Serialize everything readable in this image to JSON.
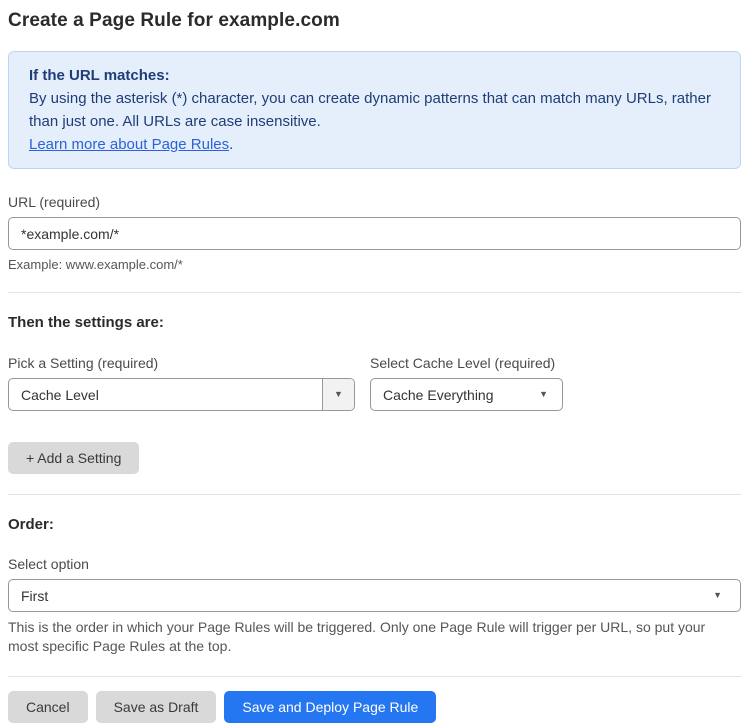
{
  "page": {
    "title": "Create a Page Rule for example.com"
  },
  "info_box": {
    "heading": "If the URL matches:",
    "body": "By using the asterisk (*) character, you can create dynamic patterns that can match many URLs, rather than just one. All URLs are case insensitive.",
    "link_label": "Learn more about Page Rules",
    "link_suffix": "."
  },
  "url_field": {
    "label": "URL (required)",
    "value": "*example.com/*",
    "helper": "Example: www.example.com/*"
  },
  "settings_section": {
    "heading": "Then the settings are:",
    "setting_picker": {
      "label": "Pick a Setting (required)",
      "value": "Cache Level"
    },
    "cache_level_picker": {
      "label": "Select Cache Level (required)",
      "value": "Cache Everything"
    },
    "add_setting_label": "+ Add a Setting"
  },
  "order_section": {
    "heading": "Order:",
    "label": "Select option",
    "value": "First",
    "helper": "This is the order in which your Page Rules will be triggered. Only one Page Rule will trigger per URL, so put your most specific Page Rules at the top."
  },
  "actions": {
    "cancel": "Cancel",
    "save_draft": "Save as Draft",
    "save_deploy": "Save and Deploy Page Rule"
  },
  "icons": {
    "dropdown_arrow": "▼"
  },
  "colors": {
    "info_bg": "#e5effc",
    "info_border": "#bcd6f2",
    "info_text": "#1f3d77",
    "link": "#2b62d9",
    "primary_button": "#2476f1",
    "secondary_button": "#d9d9d9"
  }
}
